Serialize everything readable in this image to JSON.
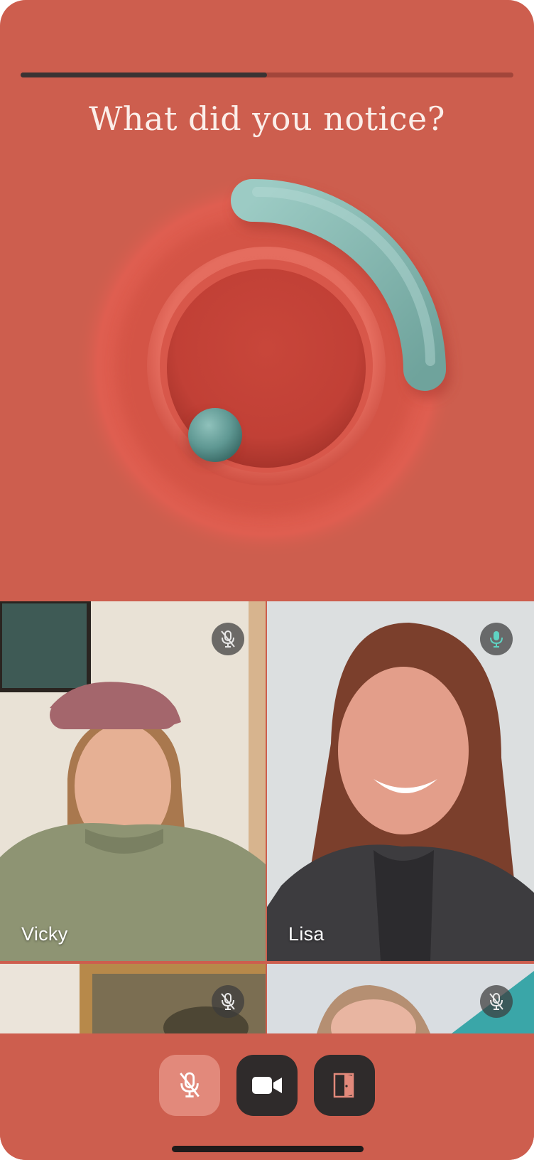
{
  "session": {
    "progress": 0.5,
    "question": "What did you notice?"
  },
  "participants": [
    {
      "name": "Vicky",
      "mic": "muted",
      "name_visible": true
    },
    {
      "name": "Lisa",
      "mic": "active",
      "name_visible": true
    },
    {
      "name": "",
      "mic": "muted",
      "name_visible": false
    },
    {
      "name": "",
      "mic": "muted",
      "name_visible": false
    }
  ],
  "controls": {
    "microphone": {
      "icon": "mic-off-icon",
      "state": "muted"
    },
    "camera": {
      "icon": "video-camera-icon",
      "state": "on"
    },
    "leave": {
      "icon": "door-exit-icon"
    }
  },
  "colors": {
    "background": "#CD5E4E",
    "accent_teal": "#7FB2AC",
    "mic_active": "#5fd3c3",
    "progress_fill": "#3a3333",
    "control_dark": "#2f2b2b",
    "control_muted": "#E2897B"
  }
}
